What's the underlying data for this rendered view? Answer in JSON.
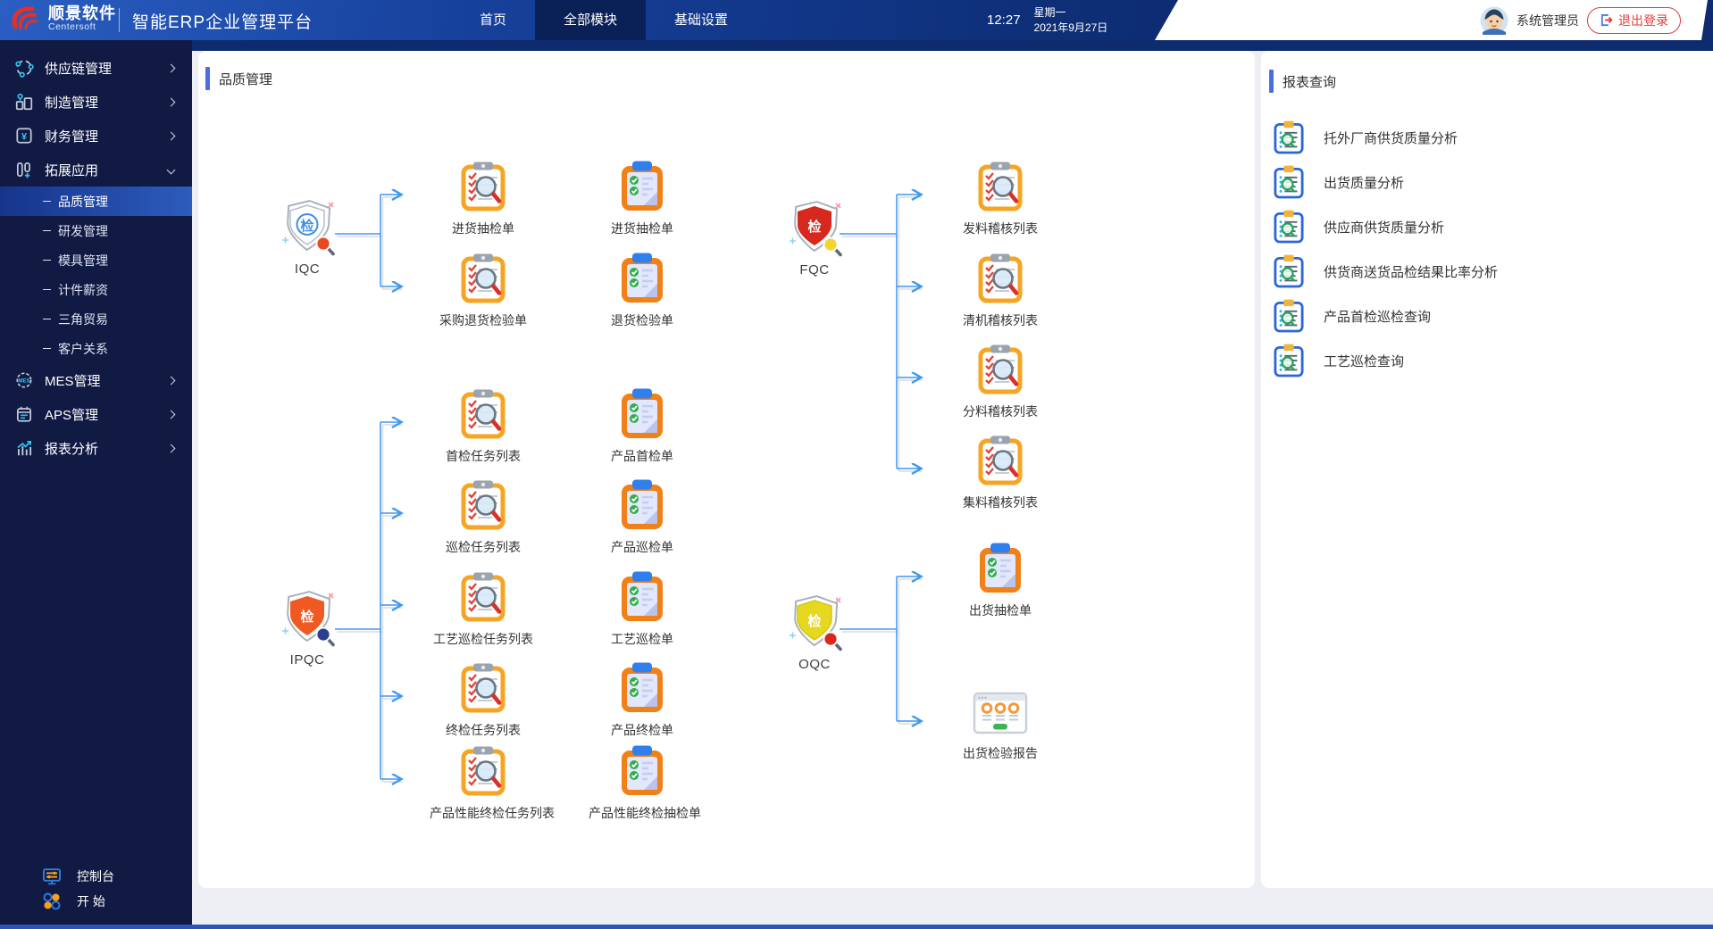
{
  "header": {
    "brand": {
      "name": "顺景软件",
      "subtitle": "Centersoft"
    },
    "app_title": "智能ERP企业管理平台",
    "nav": [
      {
        "label": "首页",
        "active": false
      },
      {
        "label": "全部模块",
        "active": true
      },
      {
        "label": "基础设置",
        "active": false
      }
    ],
    "clock": {
      "time": "12:27",
      "weekday": "星期一",
      "date": "2021年9月27日"
    },
    "user": {
      "name": "系统管理员",
      "logout": "退出登录"
    }
  },
  "sidebar": {
    "items": [
      {
        "label": "供应链管理",
        "icon": "supply-chain-icon"
      },
      {
        "label": "制造管理",
        "icon": "manufacturing-icon"
      },
      {
        "label": "财务管理",
        "icon": "finance-icon"
      },
      {
        "label": "拓展应用",
        "icon": "extensions-icon",
        "expanded": true
      },
      {
        "label": "品质管理",
        "type": "sub",
        "selected": true
      },
      {
        "label": "研发管理",
        "type": "sub"
      },
      {
        "label": "模具管理",
        "type": "sub"
      },
      {
        "label": "计件薪资",
        "type": "sub"
      },
      {
        "label": "三角贸易",
        "type": "sub"
      },
      {
        "label": "客户关系",
        "type": "sub"
      },
      {
        "label": "MES管理",
        "icon": "mes-icon"
      },
      {
        "label": "APS管理",
        "icon": "aps-icon"
      },
      {
        "label": "报表分析",
        "icon": "report-analysis-icon"
      }
    ],
    "badges": {
      "mes": "MES",
      "yen": "¥"
    },
    "footer": [
      {
        "label": "控制台",
        "icon": "console-icon"
      },
      {
        "label": "开  始",
        "icon": "start-icon"
      }
    ]
  },
  "main": {
    "title": "品质管理",
    "clusters": [
      {
        "name": "IQC",
        "shield_text": "检",
        "columns": [
          [
            "进货抽检单",
            "采购退货检验单"
          ],
          [
            "进货抽检单",
            "退货检验单"
          ]
        ]
      },
      {
        "name": "FQC",
        "shield_text": "检",
        "items": [
          "发料稽核列表",
          "清机稽核列表",
          "分料稽核列表",
          "集料稽核列表"
        ]
      },
      {
        "name": "IPQC",
        "shield_text": "检",
        "columns": [
          [
            "首检任务列表",
            "巡检任务列表",
            "工艺巡检任务列表",
            "终检任务列表",
            "产品性能终检任务列表"
          ],
          [
            "产品首检单",
            "产品巡检单",
            "工艺巡检单",
            "产品终检单",
            "产品性能终检抽检单"
          ]
        ]
      },
      {
        "name": "OQC",
        "shield_text": "检",
        "items": [
          "出货抽检单",
          "出货检验报告"
        ]
      }
    ]
  },
  "reports": {
    "title": "报表查询",
    "items": [
      "托外厂商供货质量分析",
      "出货质量分析",
      "供应商供货质量分析",
      "供货商送货品检结果比率分析",
      "产品首检巡检查询",
      "工艺巡检查询"
    ]
  },
  "colors": {
    "navbar": "#0d2d74",
    "accent": "#4a6fdc",
    "connector": "#3f97ef",
    "shield_red": "#d7281d",
    "shield_orange": "#f05a22",
    "shield_yellow": "#e5d81e",
    "clipboard_orange": "#f5a523",
    "logout_red": "#e23c38"
  }
}
